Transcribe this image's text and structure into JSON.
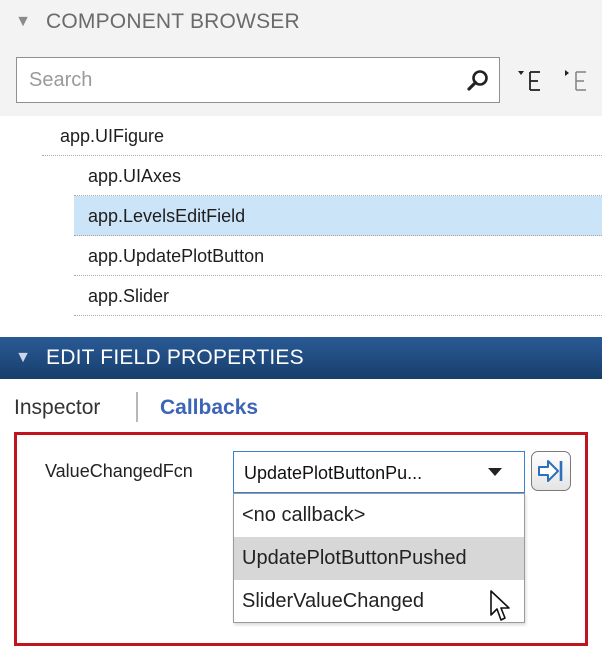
{
  "component_browser": {
    "title": "COMPONENT BROWSER",
    "search": {
      "placeholder": "Search",
      "value": ""
    },
    "tools": [
      "expand-all-icon",
      "collapse-all-icon"
    ],
    "tree": {
      "root": "app.UIFigure",
      "children": [
        {
          "label": "app.UIAxes",
          "selected": false
        },
        {
          "label": "app.LevelsEditField",
          "selected": true
        },
        {
          "label": "app.UpdatePlotButton",
          "selected": false
        },
        {
          "label": "app.Slider",
          "selected": false
        }
      ]
    }
  },
  "properties": {
    "title": "EDIT FIELD PROPERTIES",
    "tabs": [
      {
        "label": "Inspector",
        "active": false
      },
      {
        "label": "Callbacks",
        "active": true
      }
    ],
    "callback": {
      "label": "ValueChangedFcn",
      "selected_value": "UpdatePlotButtonPu...",
      "options": [
        "<no callback>",
        "UpdatePlotButtonPushed",
        "SliderValueChanged"
      ],
      "highlighted_option": "UpdatePlotButtonPushed"
    }
  },
  "colors": {
    "selection": "#cce4f7",
    "header_blue": "#1f4b80",
    "callbacks_tab": "#3d64b6",
    "highlight_border": "#c0141f"
  }
}
